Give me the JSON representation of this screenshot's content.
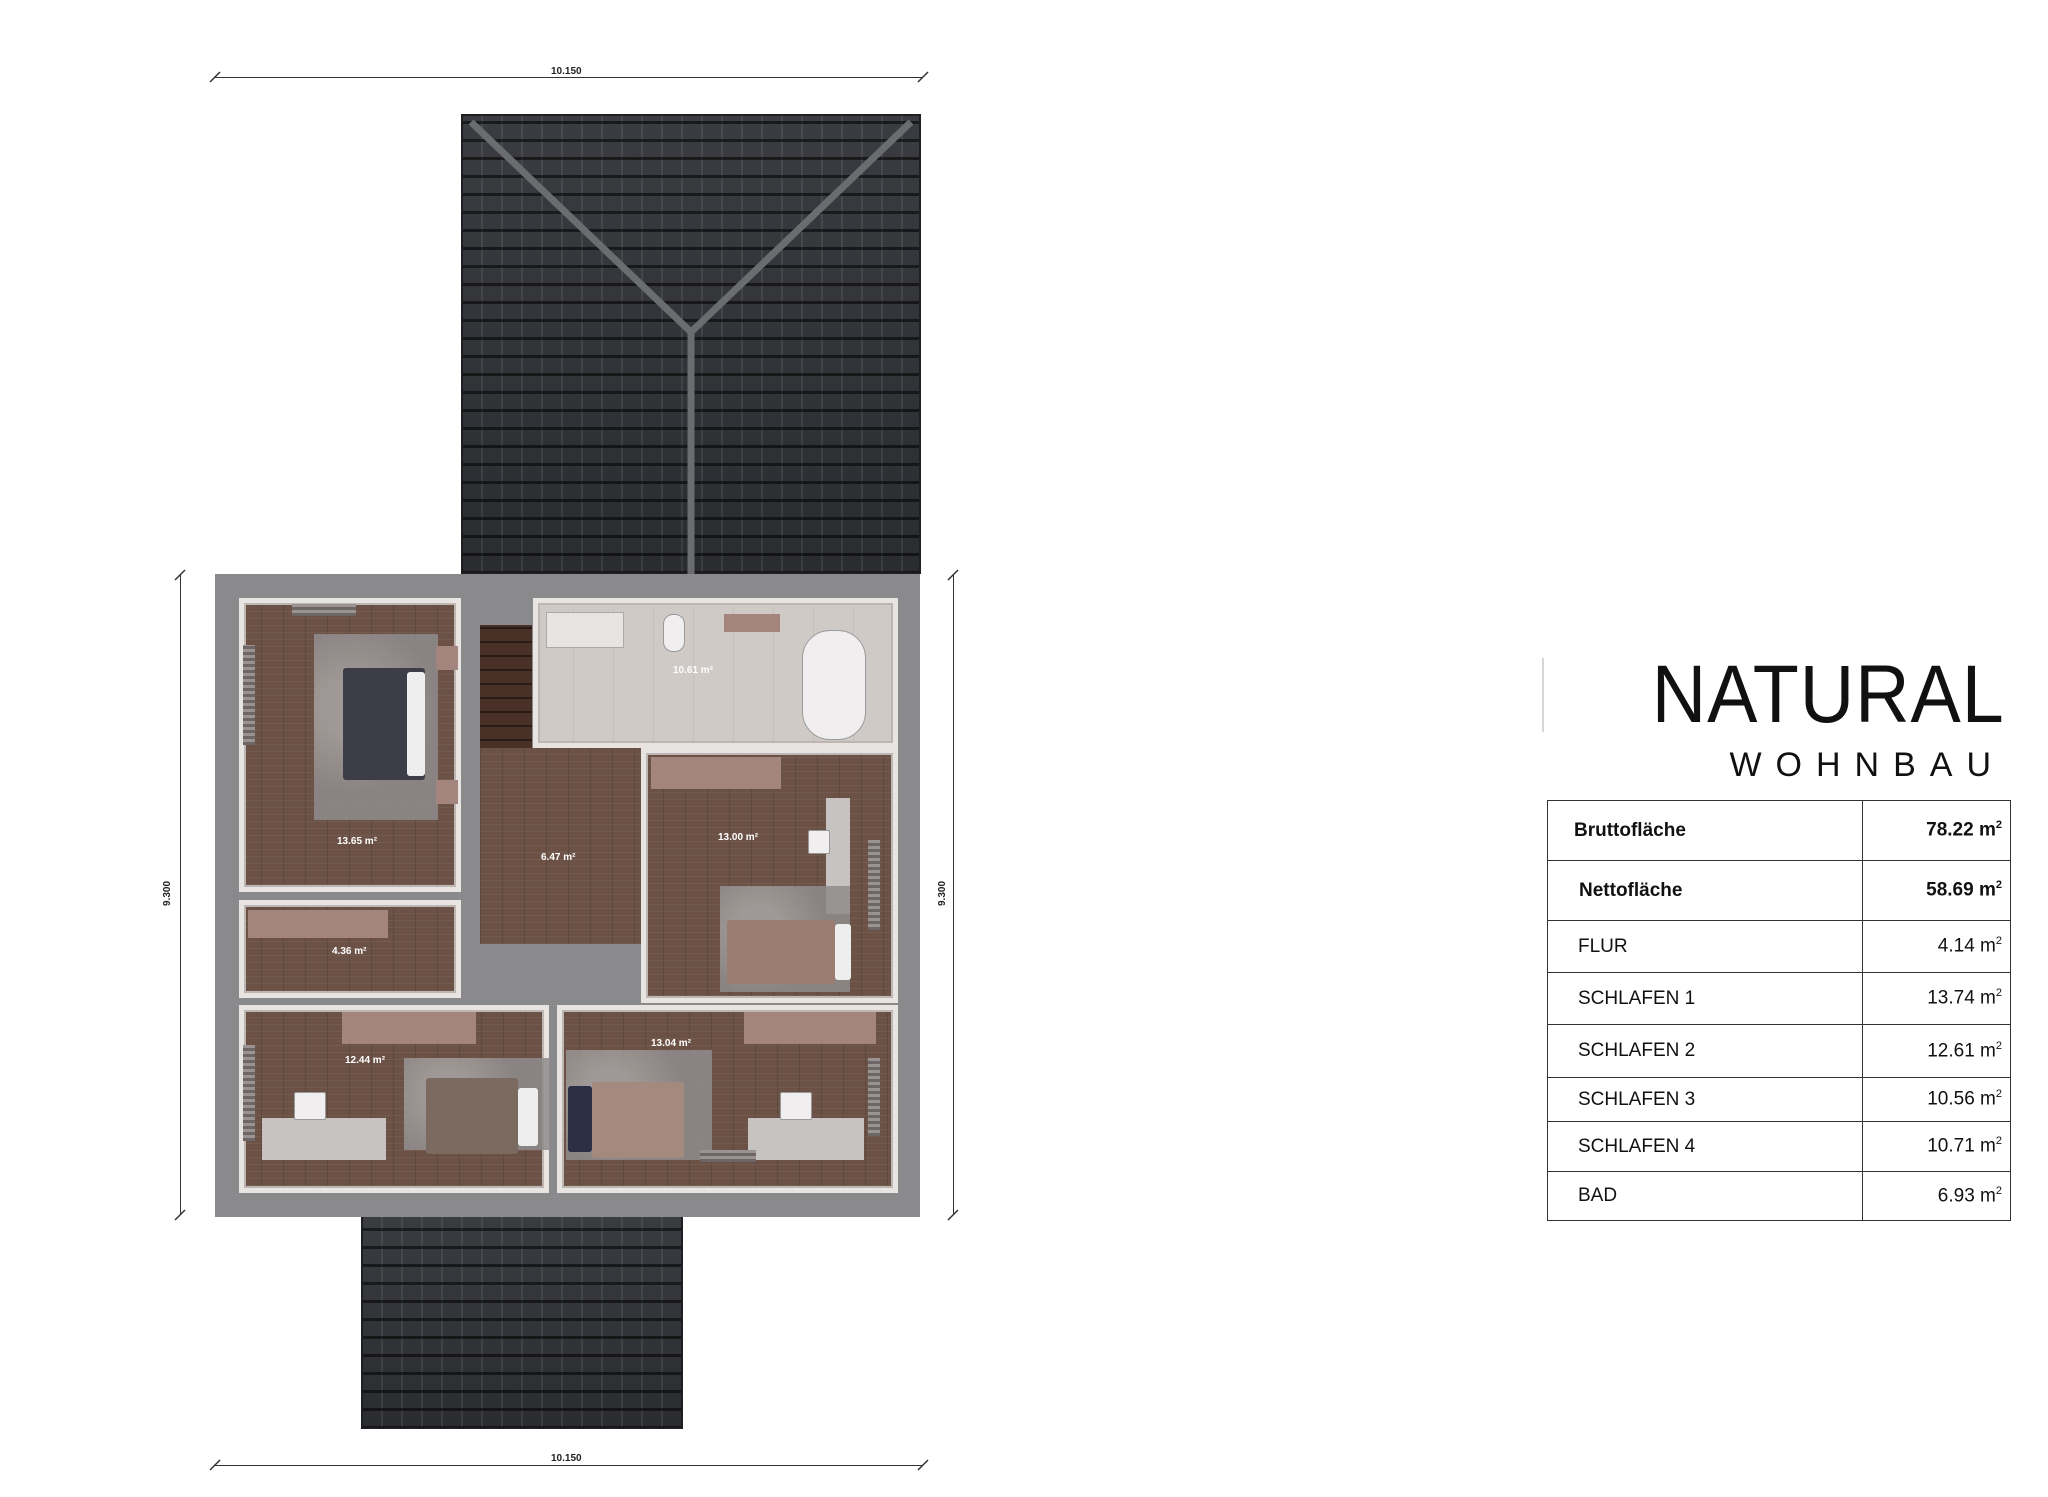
{
  "dimensions": {
    "top_width": "10.150",
    "bottom_width": "10.150",
    "left_height": "9.300",
    "right_height": "9.300"
  },
  "rooms": [
    {
      "id": "bedroom-top-left",
      "area": "13.65 m²"
    },
    {
      "id": "bathroom",
      "area": "10.61 m²"
    },
    {
      "id": "hallway",
      "area": "6.47 m²"
    },
    {
      "id": "bedroom-right",
      "area": "13.00 m²"
    },
    {
      "id": "storage",
      "area": "4.36 m²"
    },
    {
      "id": "bedroom-bottom-left",
      "area": "12.44 m²"
    },
    {
      "id": "bedroom-bottom-middle",
      "area": "13.04 m²"
    }
  ],
  "brand": {
    "title": "NATURAL",
    "subtitle": "WOHNBAU"
  },
  "area_table": [
    {
      "name": "Bruttofläche",
      "value": "78.22 m",
      "unit_sup": "2",
      "bold": true
    },
    {
      "name": "Nettofläche",
      "value": "58.69 m",
      "unit_sup": "2",
      "bold": true
    },
    {
      "name": "FLUR",
      "value": "4.14 m",
      "unit_sup": "2",
      "bold": false
    },
    {
      "name": "SCHLAFEN 1",
      "value": "13.74 m",
      "unit_sup": "2",
      "bold": false
    },
    {
      "name": "SCHLAFEN 2",
      "value": "12.61 m",
      "unit_sup": "2",
      "bold": false
    },
    {
      "name": "SCHLAFEN 3",
      "value": "10.56 m",
      "unit_sup": "2",
      "bold": false
    },
    {
      "name": "SCHLAFEN 4",
      "value": "10.71 m",
      "unit_sup": "2",
      "bold": false
    },
    {
      "name": "BAD",
      "value": "6.93 m",
      "unit_sup": "2",
      "bold": false
    }
  ]
}
